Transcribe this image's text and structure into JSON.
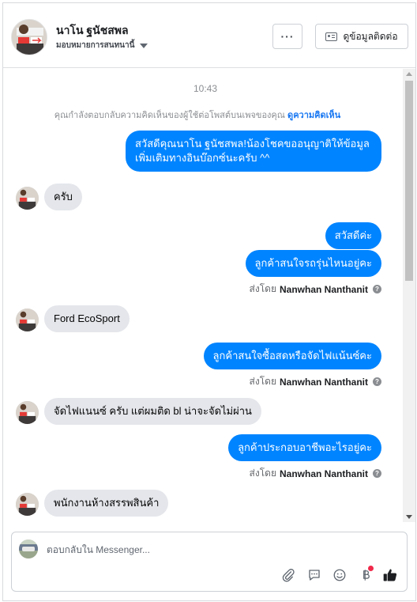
{
  "header": {
    "name": "นาโน ฐนัชสพล",
    "assign_label": "มอบหมายการสนทนานี้",
    "more_label": "···",
    "contact_label": "ดูข้อมูลติดต่อ"
  },
  "thread": {
    "timestamp": "10:43",
    "notice_text": "คุณกำลังตอบกลับความคิดเห็นของผู้ใช้ต่อโพสต์บนเพจของคุณ",
    "notice_link": "ดูความคิดเห็น",
    "messages": [
      {
        "direction": "out",
        "text": "สวัสดีคุณนาโน ฐนัชสพล!น้องโชคขออนุญาติให้ข้อมูลเพิ่มเติมทางอินบ๊อกซ์นะครับ ^^"
      },
      {
        "direction": "in",
        "text": "ครับ"
      },
      {
        "direction": "out",
        "text": "สวัสดีค่ะ"
      },
      {
        "direction": "out",
        "text": "ลูกค้าสนใจรถรุ่นไหนอยู่คะ"
      },
      {
        "direction": "in",
        "text": "Ford EcoSport"
      },
      {
        "direction": "out",
        "text": "ลูกค้าสนใจซื้อสดหรือจัดไฟแน้นซ์คะ"
      },
      {
        "direction": "in",
        "text": "จัดไฟแนนซ์ ครับ แต่ผมติด bl น่าจะจัดไม่ผ่าน"
      },
      {
        "direction": "out",
        "text": "ลูกค้าประกอบอาชีพอะไรอยู่คะ"
      },
      {
        "direction": "in",
        "text": "พนักงานห้างสรรพสินค้า"
      }
    ],
    "sent_by_prefix": "ส่งโดย",
    "sent_by_name": "Nanwhan Nanthanit"
  },
  "composer": {
    "placeholder": "ตอบกลับใน Messenger...",
    "tools": [
      "paperclip-icon",
      "speech-bubble-icon",
      "smiley-icon",
      "baht-icon",
      "thumbs-up-icon"
    ]
  },
  "colors": {
    "outgoing_bubble": "#0084ff",
    "incoming_bubble": "#e4e6eb",
    "link": "#1877f2",
    "like": "#1c1e21"
  }
}
